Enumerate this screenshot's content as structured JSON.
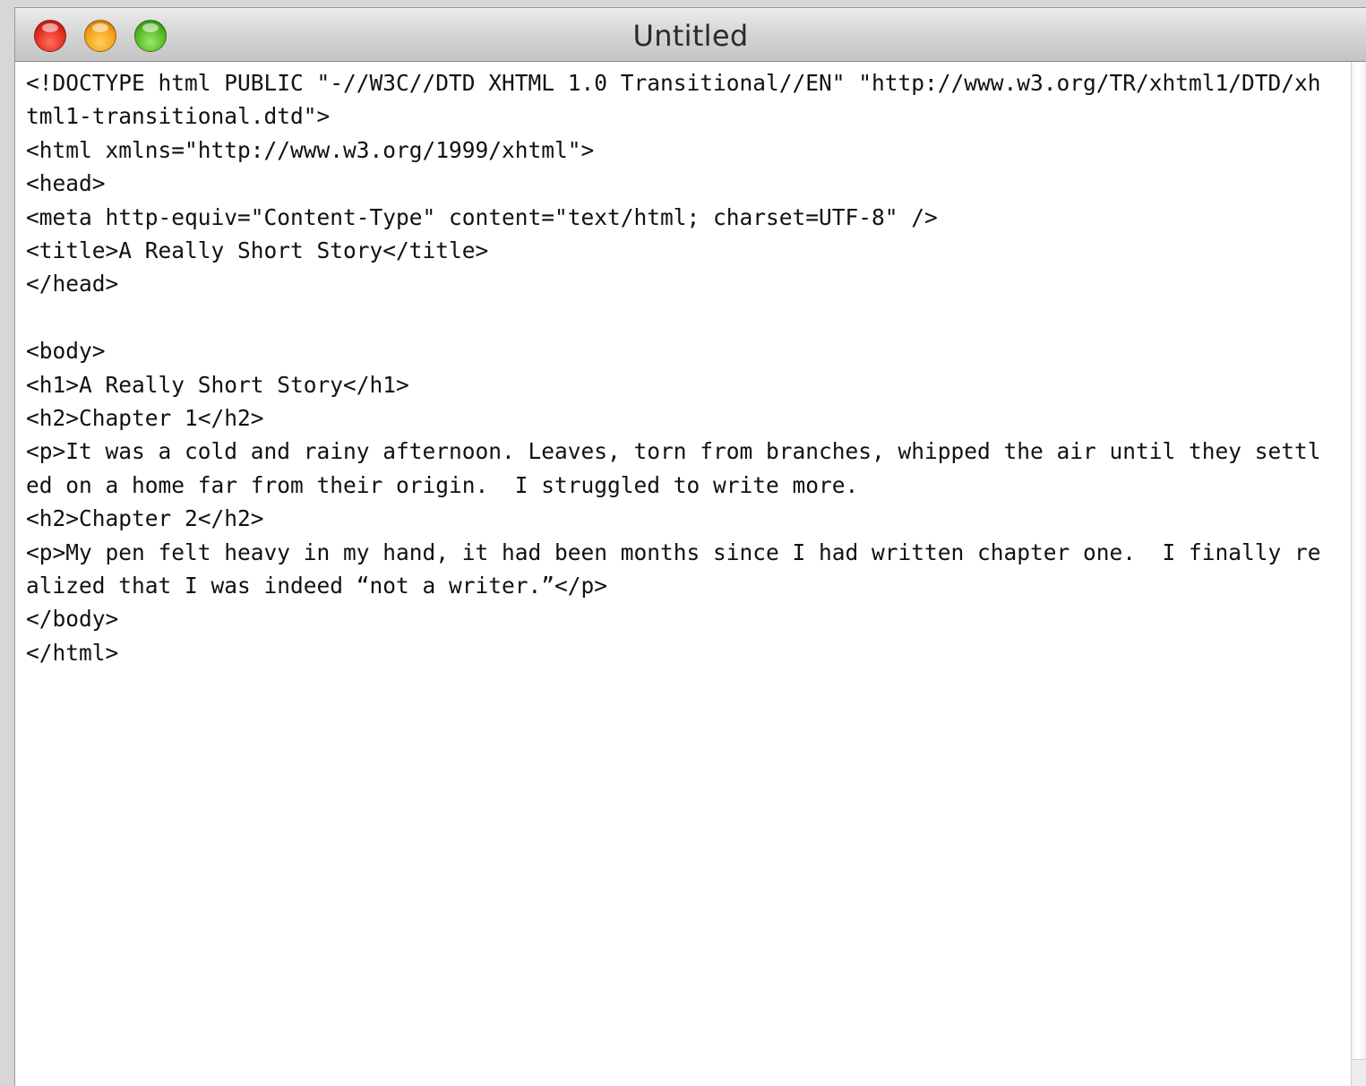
{
  "window": {
    "title": "Untitled"
  },
  "title_bar_buttons": {
    "close": "close-button",
    "minimize": "minimize-button",
    "zoom": "zoom-button"
  },
  "editor": {
    "lines": [
      "<!DOCTYPE html PUBLIC \"-//W3C//DTD XHTML 1.0 Transitional//EN\" \"http://www.w3.org/TR/xhtml1/DTD/xhtml1-transitional.dtd\">",
      "<html xmlns=\"http://www.w3.org/1999/xhtml\">",
      "<head>",
      "<meta http-equiv=\"Content-Type\" content=\"text/html; charset=UTF-8\" />",
      "<title>A Really Short Story</title>",
      "</head>",
      "",
      "<body>",
      "<h1>A Really Short Story</h1>",
      "<h2>Chapter 1</h2>",
      "<p>It was a cold and rainy afternoon. Leaves, torn from branches, whipped the air until they settled on a home far from their origin.  I struggled to write more.",
      "<h2>Chapter 2</h2>",
      "<p>My pen felt heavy in my hand, it had been months since I had written chapter one.  I finally realized that I was indeed “not a writer.”</p>",
      "</body>",
      "</html>"
    ]
  }
}
